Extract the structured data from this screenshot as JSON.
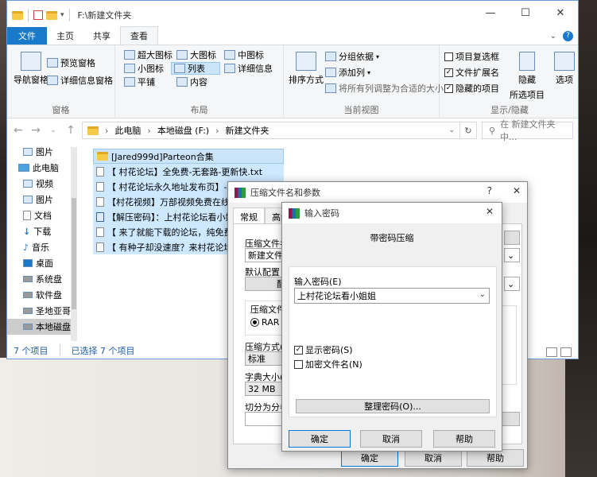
{
  "explorer": {
    "path_title": "F:\\新建文件夹",
    "tabs": [
      "文件",
      "主页",
      "共享",
      "查看"
    ],
    "ribbon": {
      "panes": {
        "nav_pane": "导航窗格",
        "preview": "预览窗格",
        "details": "详细信息窗格",
        "label": "窗格"
      },
      "layout": {
        "xl_icons": "超大图标",
        "large_icons": "大图标",
        "medium_icons": "中图标",
        "small_icons": "小图标",
        "list": "列表",
        "details": "详细信息",
        "tiles": "平铺",
        "content": "内容",
        "label": "布局"
      },
      "current_view": {
        "sort": "排序方式",
        "group_by": "分组依据",
        "add_columns": "添加列",
        "fit_columns": "将所有列调整为合适的大小",
        "label": "当前视图"
      },
      "show_hide": {
        "item_checkboxes": "项目复选框",
        "file_ext": "文件扩展名",
        "hidden_items": "隐藏的项目",
        "hide_selected": "隐藏",
        "hide_selected2": "所选项目",
        "options": "选项",
        "label": "显示/隐藏"
      }
    },
    "address": {
      "crumbs": [
        "此电脑",
        "本地磁盘 (F:)",
        "新建文件夹"
      ],
      "search_placeholder": "在 新建文件夹 中..."
    },
    "nav_items": [
      "图片",
      "此电脑",
      "视频",
      "图片",
      "文档",
      "下载",
      "音乐",
      "桌面",
      "系统盘",
      "软件盘",
      "圣地亚哥",
      "本地磁盘"
    ],
    "files": [
      "[Jared999d]Parteon合集",
      "【 村花论坛】全免费-无套路-更新快.txt",
      "【 村花论坛永久地址发布页】-点此",
      "【村花视频】万部视频免费在线看",
      "【解压密码】：上村花论坛看小姐",
      "【 来了就能下载的论坛，纯免费！",
      "【 有种子却没速度？来村花论坛人"
    ],
    "status": {
      "count": "7 个项目",
      "selected": "已选择 7 个项目"
    }
  },
  "archive_dialog": {
    "title": "压缩文件名和参数",
    "tabs": [
      "常规",
      "高级"
    ],
    "archive_name_label": "压缩文件名",
    "archive_name_value": "新建文件夹",
    "default_profile_label": "默认配置",
    "default_profile_btn": "配",
    "format_label": "压缩文件",
    "format_rar": "RAR",
    "method_label": "压缩方式(",
    "method_value": "标准",
    "dict_label": "字典大小(",
    "dict_value": "32 MB",
    "split_label": "切分为分卷",
    "ok": "确定",
    "cancel": "取消",
    "help": "帮助"
  },
  "password_dialog": {
    "title": "输入密码",
    "heading": "带密码压缩",
    "enter_label": "输入密码(E)",
    "password_value": "上村花论坛看小姐姐",
    "show_password": "显示密码(S)",
    "show_password_checked": true,
    "encrypt_names": "加密文件名(N)",
    "encrypt_names_checked": false,
    "organize": "整理密码(O)...",
    "ok": "确定",
    "cancel": "取消",
    "help": "帮助"
  }
}
